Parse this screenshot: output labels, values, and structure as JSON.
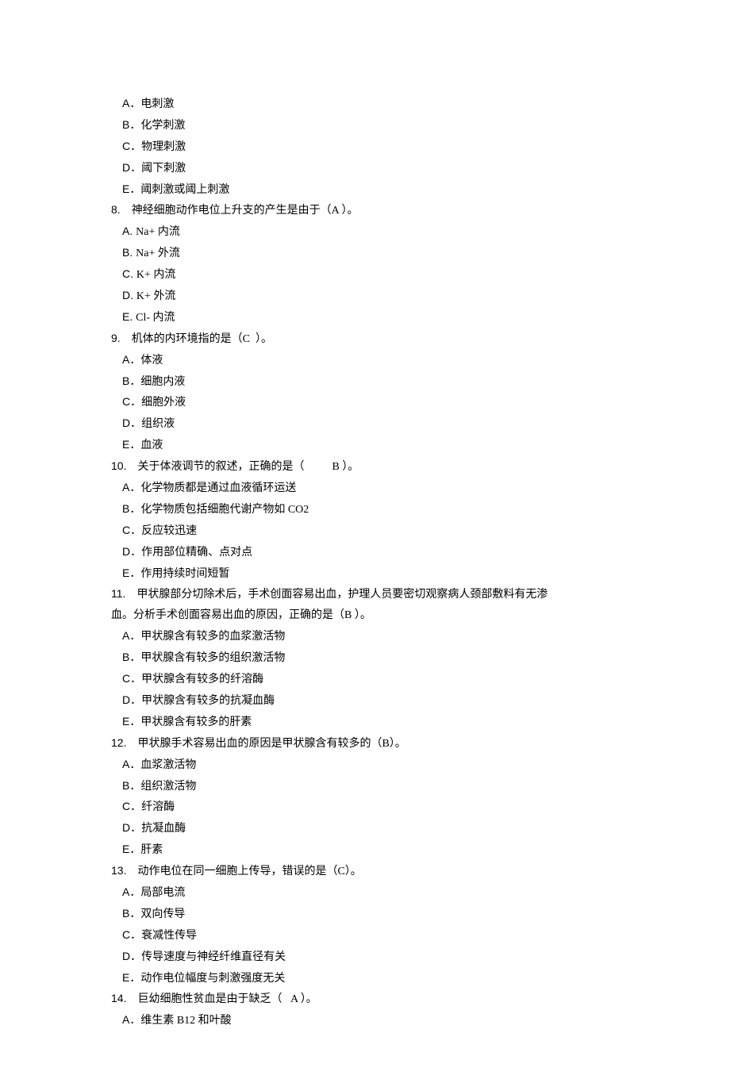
{
  "items": [
    {
      "type": "option",
      "label": "A．",
      "text": "电刺激"
    },
    {
      "type": "option",
      "label": "B．",
      "text": "化学刺激"
    },
    {
      "type": "option",
      "label": "C．",
      "text": "物理刺激"
    },
    {
      "type": "option",
      "label": "D．",
      "text": "阈下刺激"
    },
    {
      "type": "option",
      "label": "E．",
      "text": "阈刺激或阈上刺激"
    },
    {
      "type": "question",
      "num": "8.　",
      "text": "神经细胞动作电位上升支的产生是由于（A ）。"
    },
    {
      "type": "option",
      "label": "A. ",
      "text": "Na+ 内流"
    },
    {
      "type": "option",
      "label": "B. ",
      "text": "Na+ 外流"
    },
    {
      "type": "option",
      "label": "C. ",
      "text": "K+ 内流"
    },
    {
      "type": "option",
      "label": "D. ",
      "text": "K+ 外流"
    },
    {
      "type": "option",
      "label": "E. ",
      "text": "Cl- 内流"
    },
    {
      "type": "question",
      "num": "9.　",
      "text": "机体的内环境指的是（C  ）。"
    },
    {
      "type": "option",
      "label": "A．",
      "text": "体液"
    },
    {
      "type": "option",
      "label": "B．",
      "text": "细胞内液"
    },
    {
      "type": "option",
      "label": "C．",
      "text": "细胞外液"
    },
    {
      "type": "option",
      "label": "D．",
      "text": "组织液"
    },
    {
      "type": "option",
      "label": "E．",
      "text": "血液"
    },
    {
      "type": "question",
      "num": "10.　",
      "text": "关于体液调节的叙述，正确的是（          B ）。"
    },
    {
      "type": "option",
      "label": "A．",
      "text": "化学物质都是通过血液循环运送"
    },
    {
      "type": "option",
      "label": "B．",
      "text": "化学物质包括细胞代谢产物如 CO2"
    },
    {
      "type": "option",
      "label": "C．",
      "text": "反应较迅速"
    },
    {
      "type": "option",
      "label": "D．",
      "text": "作用部位精确、点对点"
    },
    {
      "type": "option",
      "label": "E．",
      "text": "作用持续时间短暂"
    },
    {
      "type": "question",
      "num": "11.　",
      "text": "甲状腺部分切除术后，手术创面容易出血，护理人员要密切观察病人颈部敷料有无渗"
    },
    {
      "type": "continuation",
      "text": "血。分析手术创面容易出血的原因，正确的是（B ）。"
    },
    {
      "type": "option",
      "label": "A．",
      "text": "甲状腺含有较多的血浆激活物"
    },
    {
      "type": "option",
      "label": "B．",
      "text": "甲状腺含有较多的组织激活物"
    },
    {
      "type": "option",
      "label": "C．",
      "text": "甲状腺含有较多的纤溶酶"
    },
    {
      "type": "option",
      "label": "D．",
      "text": "甲状腺含有较多的抗凝血酶"
    },
    {
      "type": "option",
      "label": "E．",
      "text": "甲状腺含有较多的肝素"
    },
    {
      "type": "question",
      "num": "12.　",
      "text": "甲状腺手术容易出血的原因是甲状腺含有较多的（B）。"
    },
    {
      "type": "option",
      "label": "A．",
      "text": "血浆激活物"
    },
    {
      "type": "option",
      "label": "B．",
      "text": "组织激活物"
    },
    {
      "type": "option",
      "label": "C．",
      "text": "纤溶酶"
    },
    {
      "type": "option",
      "label": "D．",
      "text": "抗凝血酶"
    },
    {
      "type": "option",
      "label": "E．",
      "text": "肝素"
    },
    {
      "type": "question",
      "num": "13.　",
      "text": "动作电位在同一细胞上传导，错误的是（C）。"
    },
    {
      "type": "option",
      "label": "A．",
      "text": "局部电流"
    },
    {
      "type": "option",
      "label": "B．",
      "text": "双向传导"
    },
    {
      "type": "option",
      "label": "C．",
      "text": "衰减性传导"
    },
    {
      "type": "option",
      "label": "D．",
      "text": "传导速度与神经纤维直径有关"
    },
    {
      "type": "option",
      "label": "E．",
      "text": "动作电位幅度与刺激强度无关"
    },
    {
      "type": "question",
      "num": "14.　",
      "text": "巨幼细胞性贫血是由于缺乏（   A ）。"
    },
    {
      "type": "option",
      "label": "A．",
      "text": "维生素 B12 和叶酸"
    }
  ]
}
